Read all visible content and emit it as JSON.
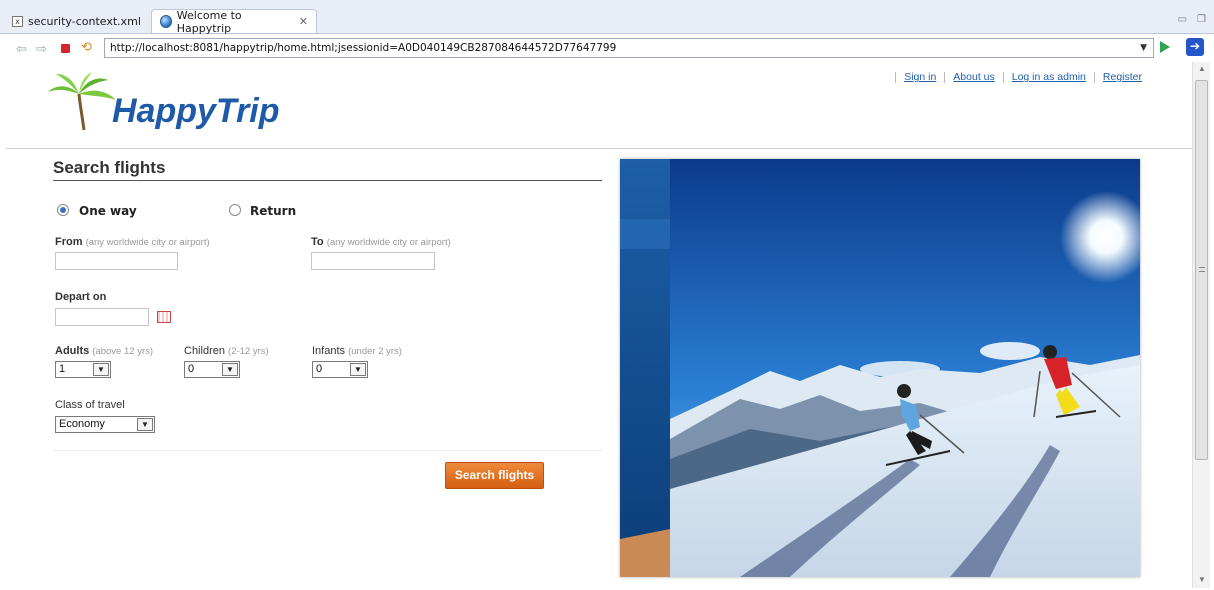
{
  "tabs": [
    {
      "label": "security-context.xml",
      "icon": "xml-file-icon"
    },
    {
      "label": "Welcome to Happytrip",
      "icon": "globe-icon",
      "active": true,
      "close_glyph": "✕"
    }
  ],
  "browser": {
    "url": "http://localhost:8081/happytrip/home.html;jsessionid=A0D040149CB287084644572D77647799"
  },
  "site": {
    "logo_text": "HappyTrip",
    "top_links": [
      "Sign in",
      "About us",
      "Log in as admin",
      "Register"
    ]
  },
  "form": {
    "title": "Search flights",
    "trip_types": [
      {
        "label": "One way",
        "selected": true
      },
      {
        "label": "Return",
        "selected": false
      }
    ],
    "from": {
      "label": "From",
      "hint": "(any worldwide city or airport)",
      "value": ""
    },
    "to": {
      "label": "To",
      "hint": "(any worldwide city or airport)",
      "value": ""
    },
    "depart": {
      "label": "Depart on",
      "value": ""
    },
    "adults": {
      "label": "Adults",
      "hint": "(above 12 yrs)",
      "value": "1"
    },
    "children": {
      "label": "Children",
      "hint": "(2-12 yrs)",
      "value": "0"
    },
    "infants": {
      "label": "Infants",
      "hint": "(under 2 yrs)",
      "value": "0"
    },
    "class_of_travel": {
      "label": "Class of travel",
      "value": "Economy"
    },
    "search_button": "Search flights"
  },
  "colors": {
    "link": "#1f5fae",
    "button": "#e2702a",
    "logo": "#1e5aa8"
  }
}
